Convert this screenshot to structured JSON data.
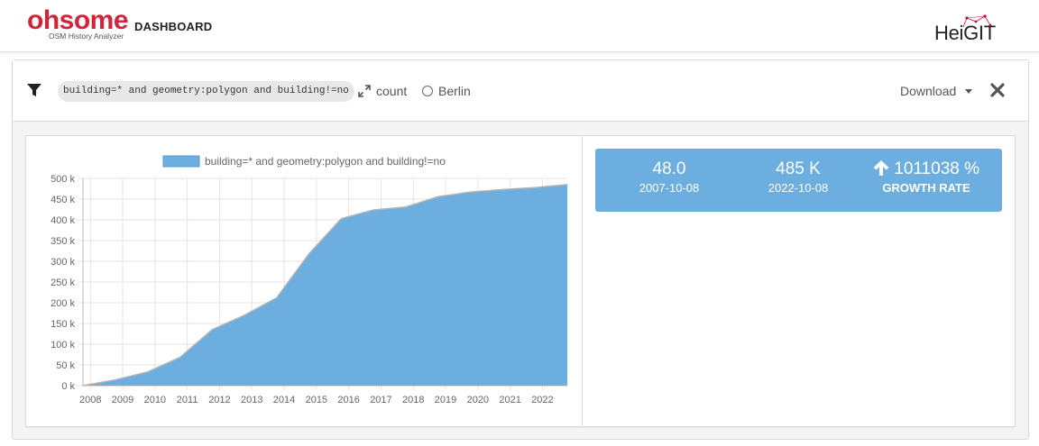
{
  "header": {
    "logo_word": "ohsome",
    "logo_sub": "OSM History Analyzer",
    "dashboard_label": "DASHBOARD",
    "partner_logo": "HeiGIT"
  },
  "toolbar": {
    "filter_icon": "filter-icon",
    "filter_text": "building=* and geometry:polygon and building!=no",
    "measure_icon": "expand-arrows-icon",
    "measure_label": "count",
    "region_icon": "radio-circle-icon",
    "region_label": "Berlin",
    "download_label": "Download",
    "close_icon": "close-x-icon"
  },
  "stats": {
    "accent_color": "#6caedf",
    "items": [
      {
        "value": "48.0",
        "label": "2007-10-08"
      },
      {
        "value": "485 K",
        "label": "2022-10-08"
      },
      {
        "icon": "arrow-up-icon",
        "value": "1011038 %",
        "label": "GROWTH RATE"
      }
    ]
  },
  "chart_data": {
    "type": "area",
    "legend": [
      "building=* and geometry:polygon and building!=no"
    ],
    "legend_placement": "top-center",
    "grid": true,
    "color": "#6caedf",
    "x_ticks": [
      "2008",
      "2009",
      "2010",
      "2011",
      "2012",
      "2013",
      "2014",
      "2015",
      "2016",
      "2017",
      "2018",
      "2019",
      "2020",
      "2021",
      "2022"
    ],
    "y_ticks": [
      "0 k",
      "50 k",
      "100 k",
      "150 k",
      "200 k",
      "250 k",
      "300 k",
      "350 k",
      "400 k",
      "450 k",
      "500 k"
    ],
    "ylim": [
      0,
      500000
    ],
    "xlim": [
      2007.77,
      2022.77
    ],
    "series": [
      {
        "name": "building=* and geometry:polygon and building!=no",
        "x": [
          2007.77,
          2008.77,
          2009.77,
          2010.77,
          2011.77,
          2012.77,
          2013.77,
          2014.77,
          2015.77,
          2016.77,
          2017.77,
          2018.77,
          2019.77,
          2020.77,
          2021.77,
          2022.77
        ],
        "y": [
          48,
          14000,
          33000,
          68000,
          135000,
          170000,
          212000,
          318000,
          403000,
          424000,
          431000,
          456000,
          467000,
          473000,
          478000,
          485000
        ]
      }
    ]
  }
}
